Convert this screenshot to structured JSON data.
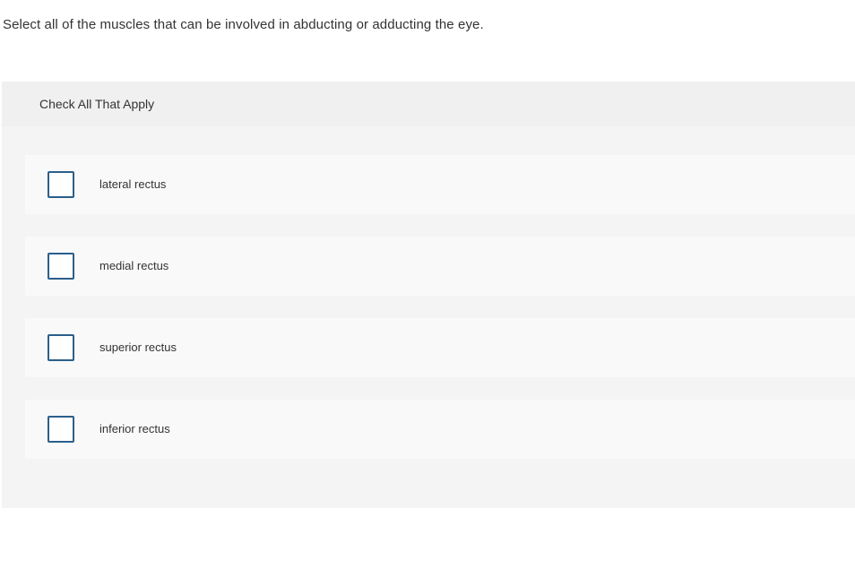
{
  "question": {
    "text": "Select all of the muscles that can be involved in abducting or adducting the eye."
  },
  "panel": {
    "header": "Check All That Apply",
    "options": [
      {
        "label": "lateral rectus",
        "checked": false
      },
      {
        "label": "medial rectus",
        "checked": false
      },
      {
        "label": "superior rectus",
        "checked": false
      },
      {
        "label": "inferior rectus",
        "checked": false
      }
    ]
  },
  "colors": {
    "checkbox_border": "#2b5f8a",
    "panel_bg": "#f4f4f4",
    "option_bg": "#f9f9f9"
  }
}
